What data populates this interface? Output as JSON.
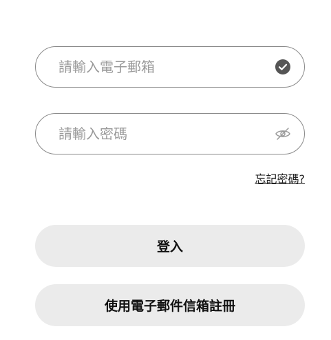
{
  "email": {
    "placeholder": "請輸入電子郵箱",
    "value": "",
    "status_icon": "check-circle-icon"
  },
  "password": {
    "placeholder": "請輸入密碼",
    "value": "",
    "toggle_icon": "eye-off-icon"
  },
  "forgot_password_label": "忘記密碼?",
  "buttons": {
    "login_label": "登入",
    "register_label": "使用電子郵件信箱註冊"
  },
  "colors": {
    "button_bg": "#ebebeb",
    "field_border": "#8a8a8a",
    "placeholder": "#9a9a9a",
    "check_icon": "#555555"
  }
}
